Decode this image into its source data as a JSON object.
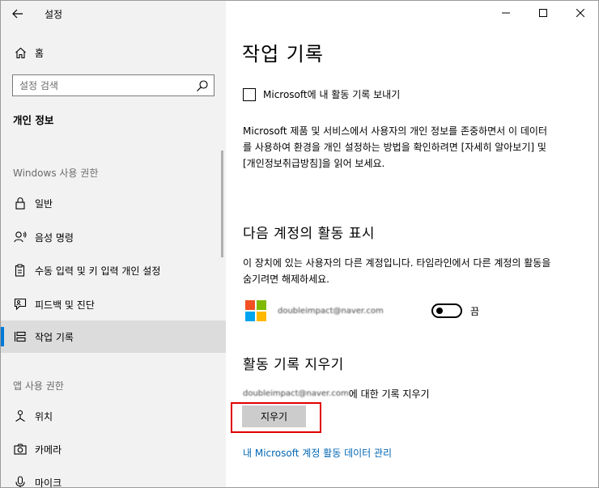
{
  "app": {
    "title": "설정"
  },
  "sidebar": {
    "home_label": "홈",
    "search_placeholder": "설정 검색",
    "section_title": "개인 정보",
    "windows_group": "Windows 사용 권한",
    "windows_items": [
      {
        "label": "일반",
        "icon": "lock-icon"
      },
      {
        "label": "음성 명령",
        "icon": "speech-icon"
      },
      {
        "label": "수동 입력 및 키 입력 개인 설정",
        "icon": "clipboard-pen-icon"
      },
      {
        "label": "피드백 및 진단",
        "icon": "feedback-icon"
      },
      {
        "label": "작업 기록",
        "icon": "timeline-icon",
        "active": true
      }
    ],
    "app_group": "앱 사용 권한",
    "app_items": [
      {
        "label": "위치",
        "icon": "location-icon"
      },
      {
        "label": "카메라",
        "icon": "camera-icon"
      },
      {
        "label": "마이크",
        "icon": "microphone-icon"
      }
    ]
  },
  "content": {
    "page_title": "작업 기록",
    "send_checkbox": {
      "label": "Microsoft에 내 활동 기록 보내기",
      "checked": false
    },
    "privacy_text": "Microsoft 제품 및 서비스에서 사용자의 개인 정보를 존중하면서 이 데이터를 사용하여 환경을 개인 설정하는 방법을 확인하려면 [자세히 알아보기] 및 [개인정보취급방침]을 읽어 보세요.",
    "show_heading": "다음 계정의 활동 표시",
    "show_desc": "이 장치에 있는 사용자의 다른 계정입니다. 타임라인에서 다른 계정의 활동을 숨기려면 해제하세요.",
    "account_email": "doubleimpact@naver.com",
    "toggle_state": "끔",
    "clear_heading": "활동 기록 지우기",
    "clear_email": "doubleimpact@naver.com",
    "clear_suffix": "에 대한 기록 지우기",
    "clear_button": "지우기",
    "manage_link": "내 Microsoft 계정 활동 데이터 관리"
  },
  "colors": {
    "accent": "#0078d7",
    "link": "#0066b4",
    "highlight": "#e00000",
    "ms_red": "#f25022",
    "ms_green": "#7fba00",
    "ms_blue": "#00a4ef",
    "ms_yellow": "#ffb900"
  }
}
